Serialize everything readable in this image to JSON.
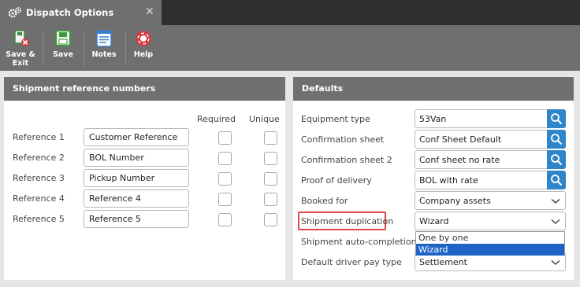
{
  "window": {
    "title": "Dispatch Options",
    "close_glyph": "✕"
  },
  "toolbar": {
    "save_exit_line1": "Save &",
    "save_exit_line2": "Exit",
    "save": "Save",
    "notes": "Notes",
    "help": "Help"
  },
  "references": {
    "title": "Shipment reference numbers",
    "col_required": "Required",
    "col_unique": "Unique",
    "rows": [
      {
        "label": "Reference 1",
        "value": "Customer Reference",
        "required": false,
        "unique": false
      },
      {
        "label": "Reference 2",
        "value": "BOL Number",
        "required": false,
        "unique": false
      },
      {
        "label": "Reference 3",
        "value": "Pickup Number",
        "required": false,
        "unique": false
      },
      {
        "label": "Reference 4",
        "value": "Reference 4",
        "required": false,
        "unique": false
      },
      {
        "label": "Reference 5",
        "value": "Reference 5",
        "required": false,
        "unique": false
      }
    ]
  },
  "defaults": {
    "title": "Defaults",
    "equipment_type": {
      "label": "Equipment type",
      "value": "53Van"
    },
    "confirmation_sheet": {
      "label": "Confirmation sheet",
      "value": "Conf Sheet Default"
    },
    "confirmation_sheet_2": {
      "label": "Confirmation sheet 2",
      "value": "Conf sheet no rate"
    },
    "proof_of_delivery": {
      "label": "Proof of delivery",
      "value": "BOL with rate"
    },
    "booked_for": {
      "label": "Booked for",
      "value": "Company assets"
    },
    "shipment_duplication": {
      "label": "Shipment duplication",
      "value": "Wizard",
      "options": [
        "One by one",
        "Wizard"
      ]
    },
    "shipment_auto_completion": {
      "label": "Shipment auto-completion"
    },
    "default_driver_pay_type": {
      "label": "Default driver pay type",
      "value": "Settlement"
    }
  },
  "colors": {
    "accent": "#2f85c9",
    "highlight": "#e0474c",
    "selected": "#1f63c6"
  }
}
